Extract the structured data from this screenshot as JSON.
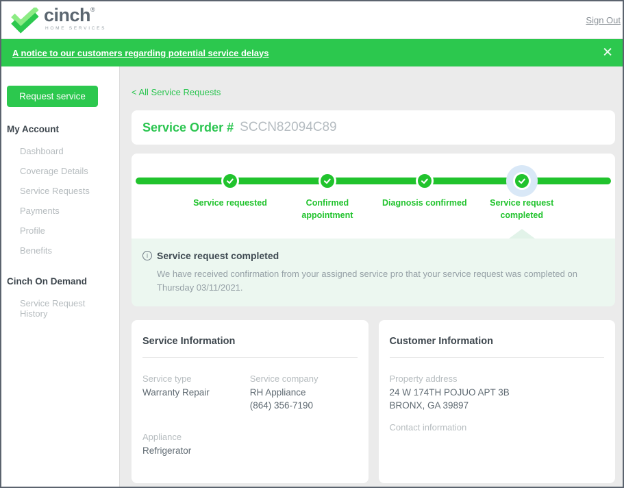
{
  "header": {
    "brand": "cinch",
    "brand_mark": "®",
    "tagline": "HOME SERVICES",
    "sign_out_label": "Sign Out"
  },
  "banner": {
    "text": "A notice to our customers regarding potential service delays",
    "close_icon": "✕"
  },
  "sidebar": {
    "request_service_label": "Request service",
    "sections": [
      {
        "heading": "My Account",
        "items": [
          "Dashboard",
          "Coverage Details",
          "Service Requests",
          "Payments",
          "Profile",
          "Benefits"
        ]
      },
      {
        "heading": "Cinch On Demand",
        "items": [
          "Service Request History"
        ]
      }
    ]
  },
  "main": {
    "back_link": "< All Service Requests",
    "order": {
      "label": "Service Order #",
      "number": "SCCN82094C89"
    },
    "progress": {
      "steps": [
        {
          "label": "Service requested",
          "completed": true
        },
        {
          "label": "Confirmed appointment",
          "completed": true
        },
        {
          "label": "Diagnosis confirmed",
          "completed": true
        },
        {
          "label": "Service request completed",
          "completed": true,
          "active": true
        }
      ]
    },
    "status": {
      "title": "Service request completed",
      "body": "We have received confirmation from your assigned service pro that your service request was completed on Thursday 03/11/2021."
    },
    "service_info": {
      "title": "Service Information",
      "fields": [
        {
          "label": "Service type",
          "lines": [
            "Warranty Repair"
          ]
        },
        {
          "label": "Service company",
          "lines": [
            "RH Appliance",
            "(864) 356-7190"
          ]
        },
        {
          "label": "Appliance",
          "lines": [
            "Refrigerator"
          ]
        }
      ]
    },
    "customer_info": {
      "title": "Customer Information",
      "fields": [
        {
          "label": "Property address",
          "lines": [
            "24 W 174TH POJUO APT 3B",
            "BRONX, GA 39897"
          ]
        },
        {
          "label": "Contact information",
          "lines": []
        }
      ]
    }
  },
  "colors": {
    "brand_green": "#2cc84e",
    "progress_green": "#21c32d",
    "status_bg": "#ecf7f0",
    "caret_mint": "#e2f3e9",
    "active_halo_blue": "#d9e8f7",
    "page_bg": "#ebebeb",
    "window_border": "#5b636e"
  }
}
